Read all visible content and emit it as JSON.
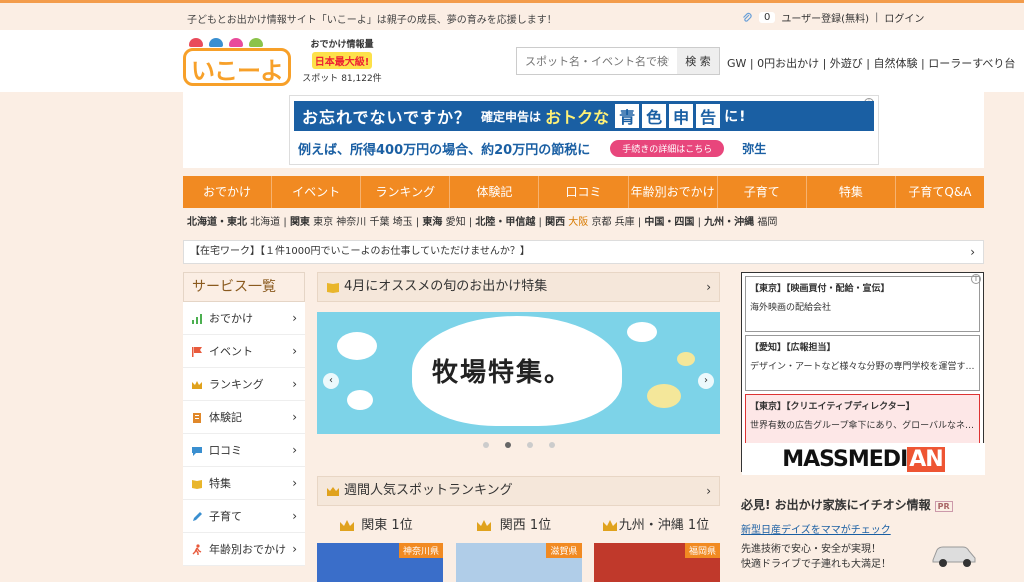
{
  "topbar": {
    "tagline": "子どもとお出かけ情報サイト「いこーよ」は親子の成長、夢の育みを応援します！",
    "clip_count": "0",
    "register": "ユーザー登録(無料)",
    "sep": "|",
    "login": "ログイン"
  },
  "header": {
    "logo_text": "いこーよ",
    "promo_small": "おでかけ情報量",
    "promo_big": "日本最大級!",
    "spots_label": "スポット",
    "spots_count": "81,122件",
    "search_placeholder": "スポット名・イベント名で検索",
    "search_button": "検 索",
    "quick_links": "GW | 0円お出かけ | 外遊び | 自然体験 | ローラーすべり台"
  },
  "ad": {
    "line1": "お忘れでないですか？",
    "line1b": "確定申告は",
    "line1c": "おトクな",
    "blocks": [
      "青",
      "色",
      "申",
      "告"
    ],
    "line1d": "に!",
    "line2": "例えば、所得400万円の場合、約20万円の節税に",
    "cta": "手続きの詳細はこちら",
    "brand": "弥生",
    "info": "i"
  },
  "nav": [
    "おでかけ",
    "イベント",
    "ランキング",
    "体験記",
    "口コミ",
    "年齢別おでかけ",
    "子育て",
    "特集",
    "子育てQ&A"
  ],
  "regions": {
    "r1": "北海道・東北",
    "r1a": "北海道",
    "r2": "関東",
    "r2a": "東京 神奈川 千葉 埼玉",
    "r3": "東海",
    "r3a": "愛知",
    "r4": "北陸・甲信越",
    "r5": "関西",
    "r5hl": "大阪",
    "r5a": "京都 兵庫",
    "r6": "中国・四国",
    "r7": "九州・沖縄",
    "r7a": "福岡",
    "sep": "|"
  },
  "notice": {
    "text": "【在宅ワーク】【１件1000円でいこーよのお仕事していただけませんか？】",
    "chev": "›"
  },
  "sidebar": {
    "title": "サービス一覧",
    "items": [
      {
        "label": "おでかけ",
        "color": "#4caf50"
      },
      {
        "label": "イベント",
        "color": "#e85a3c"
      },
      {
        "label": "ランキング",
        "color": "#e0a21d"
      },
      {
        "label": "体験記",
        "color": "#e0882a"
      },
      {
        "label": "口コミ",
        "color": "#3a8fd0"
      },
      {
        "label": "特集",
        "color": "#e9b62b"
      },
      {
        "label": "子育て",
        "color": "#3a8fd0"
      },
      {
        "label": "年齢別おでかけ",
        "color": "#e85a3c"
      }
    ],
    "chev": "›"
  },
  "main": {
    "feature_title": "4月にオススメの旬のお出かけ特集",
    "carousel_title": "牧場特集。",
    "prev": "‹",
    "next": "›",
    "chev": "›",
    "ranking_title": "週間人気スポットランキング",
    "ranks": [
      {
        "label": "関東 1位",
        "pref": "神奈川県",
        "bg": "#3a6ec9"
      },
      {
        "label": "関西 1位",
        "pref": "滋賀県",
        "bg": "#b0cde8"
      },
      {
        "label": "九州・沖縄 1位",
        "pref": "福岡県",
        "bg": "#c0392b"
      }
    ]
  },
  "right": {
    "jobs": [
      {
        "title": "【東京】【映画買付・配給・宣伝】",
        "desc": "海外映画の配給会社"
      },
      {
        "title": "【愛知】【広報担当】",
        "desc": "デザイン・アートなど様々な分野の専門学校を運営す…"
      },
      {
        "title": "【東京】【クリエイティブディレクター】",
        "desc": "世界有数の広告グループ傘下にあり、グローバルなネ…"
      }
    ],
    "brand_a": "MASSMEDI",
    "brand_b": "AN",
    "info_head": "必見! お出かけ家族にイチオシ情報",
    "pr": "PR",
    "link": "新型日産デイズをママがチェック",
    "text1": "先進技術で安心・安全が実現！",
    "text2": "快適ドライブで子連れも大満足！",
    "info": "i"
  }
}
